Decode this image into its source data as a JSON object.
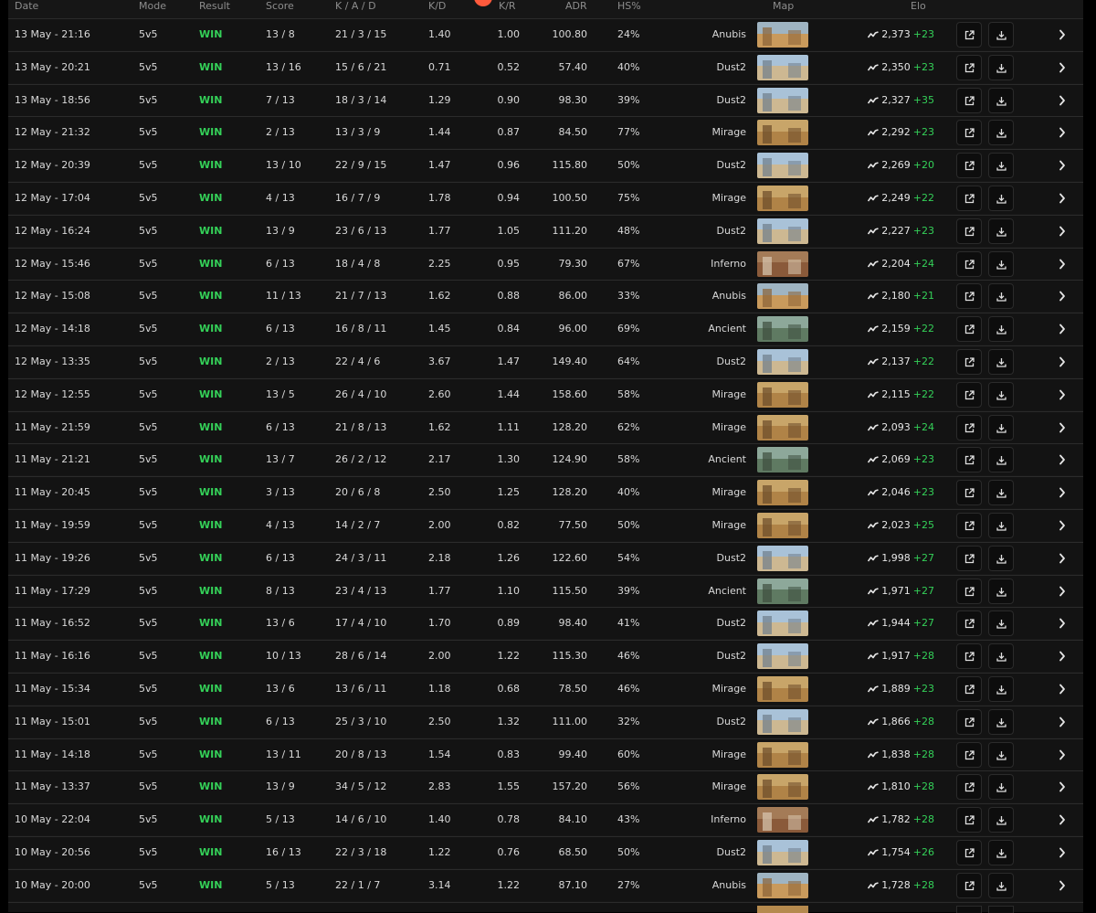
{
  "header": {
    "date": "Date",
    "mode": "Mode",
    "result": "Result",
    "score": "Score",
    "kad": "K / A / D",
    "kd": "K/D",
    "kr": "K/R",
    "adr": "ADR",
    "hs": "HS%",
    "map": "Map",
    "elo": "Elo"
  },
  "colors": {
    "win": "#34d058",
    "delta": "#34d058",
    "background": "#161616",
    "logo": "#ff5a3c"
  },
  "icons": {
    "trend": "trend-chart-icon",
    "external": "external-link-icon",
    "download": "download-icon",
    "chevron": "chevron-right-icon"
  },
  "matches": [
    {
      "date": "13 May - 21:16",
      "mode": "5v5",
      "result": "WIN",
      "score": "13 / 8",
      "kad": "21 / 3 / 15",
      "kd": "1.40",
      "kr": "1.00",
      "adr": "100.80",
      "hs": "24%",
      "map": "Anubis",
      "elo": "2,373",
      "delta": "+23"
    },
    {
      "date": "13 May - 20:21",
      "mode": "5v5",
      "result": "WIN",
      "score": "13 / 16",
      "kad": "15 / 6 / 21",
      "kd": "0.71",
      "kr": "0.52",
      "adr": "57.40",
      "hs": "40%",
      "map": "Dust2",
      "elo": "2,350",
      "delta": "+23"
    },
    {
      "date": "13 May - 18:56",
      "mode": "5v5",
      "result": "WIN",
      "score": "7 / 13",
      "kad": "18 / 3 / 14",
      "kd": "1.29",
      "kr": "0.90",
      "adr": "98.30",
      "hs": "39%",
      "map": "Dust2",
      "elo": "2,327",
      "delta": "+35"
    },
    {
      "date": "12 May - 21:32",
      "mode": "5v5",
      "result": "WIN",
      "score": "2 / 13",
      "kad": "13 / 3 / 9",
      "kd": "1.44",
      "kr": "0.87",
      "adr": "84.50",
      "hs": "77%",
      "map": "Mirage",
      "elo": "2,292",
      "delta": "+23"
    },
    {
      "date": "12 May - 20:39",
      "mode": "5v5",
      "result": "WIN",
      "score": "13 / 10",
      "kad": "22 / 9 / 15",
      "kd": "1.47",
      "kr": "0.96",
      "adr": "115.80",
      "hs": "50%",
      "map": "Dust2",
      "elo": "2,269",
      "delta": "+20"
    },
    {
      "date": "12 May - 17:04",
      "mode": "5v5",
      "result": "WIN",
      "score": "4 / 13",
      "kad": "16 / 7 / 9",
      "kd": "1.78",
      "kr": "0.94",
      "adr": "100.50",
      "hs": "75%",
      "map": "Mirage",
      "elo": "2,249",
      "delta": "+22"
    },
    {
      "date": "12 May - 16:24",
      "mode": "5v5",
      "result": "WIN",
      "score": "13 / 9",
      "kad": "23 / 6 / 13",
      "kd": "1.77",
      "kr": "1.05",
      "adr": "111.20",
      "hs": "48%",
      "map": "Dust2",
      "elo": "2,227",
      "delta": "+23"
    },
    {
      "date": "12 May - 15:46",
      "mode": "5v5",
      "result": "WIN",
      "score": "6 / 13",
      "kad": "18 / 4 / 8",
      "kd": "2.25",
      "kr": "0.95",
      "adr": "79.30",
      "hs": "67%",
      "map": "Inferno",
      "elo": "2,204",
      "delta": "+24"
    },
    {
      "date": "12 May - 15:08",
      "mode": "5v5",
      "result": "WIN",
      "score": "11 / 13",
      "kad": "21 / 7 / 13",
      "kd": "1.62",
      "kr": "0.88",
      "adr": "86.00",
      "hs": "33%",
      "map": "Anubis",
      "elo": "2,180",
      "delta": "+21"
    },
    {
      "date": "12 May - 14:18",
      "mode": "5v5",
      "result": "WIN",
      "score": "6 / 13",
      "kad": "16 / 8 / 11",
      "kd": "1.45",
      "kr": "0.84",
      "adr": "96.00",
      "hs": "69%",
      "map": "Ancient",
      "elo": "2,159",
      "delta": "+22"
    },
    {
      "date": "12 May - 13:35",
      "mode": "5v5",
      "result": "WIN",
      "score": "2 / 13",
      "kad": "22 / 4 / 6",
      "kd": "3.67",
      "kr": "1.47",
      "adr": "149.40",
      "hs": "64%",
      "map": "Dust2",
      "elo": "2,137",
      "delta": "+22"
    },
    {
      "date": "12 May - 12:55",
      "mode": "5v5",
      "result": "WIN",
      "score": "13 / 5",
      "kad": "26 / 4 / 10",
      "kd": "2.60",
      "kr": "1.44",
      "adr": "158.60",
      "hs": "58%",
      "map": "Mirage",
      "elo": "2,115",
      "delta": "+22"
    },
    {
      "date": "11 May - 21:59",
      "mode": "5v5",
      "result": "WIN",
      "score": "6 / 13",
      "kad": "21 / 8 / 13",
      "kd": "1.62",
      "kr": "1.11",
      "adr": "128.20",
      "hs": "62%",
      "map": "Mirage",
      "elo": "2,093",
      "delta": "+24"
    },
    {
      "date": "11 May - 21:21",
      "mode": "5v5",
      "result": "WIN",
      "score": "13 / 7",
      "kad": "26 / 2 / 12",
      "kd": "2.17",
      "kr": "1.30",
      "adr": "124.90",
      "hs": "58%",
      "map": "Ancient",
      "elo": "2,069",
      "delta": "+23"
    },
    {
      "date": "11 May - 20:45",
      "mode": "5v5",
      "result": "WIN",
      "score": "3 / 13",
      "kad": "20 / 6 / 8",
      "kd": "2.50",
      "kr": "1.25",
      "adr": "128.20",
      "hs": "40%",
      "map": "Mirage",
      "elo": "2,046",
      "delta": "+23"
    },
    {
      "date": "11 May - 19:59",
      "mode": "5v5",
      "result": "WIN",
      "score": "4 / 13",
      "kad": "14 / 2 / 7",
      "kd": "2.00",
      "kr": "0.82",
      "adr": "77.50",
      "hs": "50%",
      "map": "Mirage",
      "elo": "2,023",
      "delta": "+25"
    },
    {
      "date": "11 May - 19:26",
      "mode": "5v5",
      "result": "WIN",
      "score": "6 / 13",
      "kad": "24 / 3 / 11",
      "kd": "2.18",
      "kr": "1.26",
      "adr": "122.60",
      "hs": "54%",
      "map": "Dust2",
      "elo": "1,998",
      "delta": "+27"
    },
    {
      "date": "11 May - 17:29",
      "mode": "5v5",
      "result": "WIN",
      "score": "8 / 13",
      "kad": "23 / 4 / 13",
      "kd": "1.77",
      "kr": "1.10",
      "adr": "115.50",
      "hs": "39%",
      "map": "Ancient",
      "elo": "1,971",
      "delta": "+27"
    },
    {
      "date": "11 May - 16:52",
      "mode": "5v5",
      "result": "WIN",
      "score": "13 / 6",
      "kad": "17 / 4 / 10",
      "kd": "1.70",
      "kr": "0.89",
      "adr": "98.40",
      "hs": "41%",
      "map": "Dust2",
      "elo": "1,944",
      "delta": "+27"
    },
    {
      "date": "11 May - 16:16",
      "mode": "5v5",
      "result": "WIN",
      "score": "10 / 13",
      "kad": "28 / 6 / 14",
      "kd": "2.00",
      "kr": "1.22",
      "adr": "115.30",
      "hs": "46%",
      "map": "Dust2",
      "elo": "1,917",
      "delta": "+28"
    },
    {
      "date": "11 May - 15:34",
      "mode": "5v5",
      "result": "WIN",
      "score": "13 / 6",
      "kad": "13 / 6 / 11",
      "kd": "1.18",
      "kr": "0.68",
      "adr": "78.50",
      "hs": "46%",
      "map": "Mirage",
      "elo": "1,889",
      "delta": "+23"
    },
    {
      "date": "11 May - 15:01",
      "mode": "5v5",
      "result": "WIN",
      "score": "6 / 13",
      "kad": "25 / 3 / 10",
      "kd": "2.50",
      "kr": "1.32",
      "adr": "111.00",
      "hs": "32%",
      "map": "Dust2",
      "elo": "1,866",
      "delta": "+28"
    },
    {
      "date": "11 May - 14:18",
      "mode": "5v5",
      "result": "WIN",
      "score": "13 / 11",
      "kad": "20 / 8 / 13",
      "kd": "1.54",
      "kr": "0.83",
      "adr": "99.40",
      "hs": "60%",
      "map": "Mirage",
      "elo": "1,838",
      "delta": "+28"
    },
    {
      "date": "11 May - 13:37",
      "mode": "5v5",
      "result": "WIN",
      "score": "13 / 9",
      "kad": "34 / 5 / 12",
      "kd": "2.83",
      "kr": "1.55",
      "adr": "157.20",
      "hs": "56%",
      "map": "Mirage",
      "elo": "1,810",
      "delta": "+28"
    },
    {
      "date": "10 May - 22:04",
      "mode": "5v5",
      "result": "WIN",
      "score": "5 / 13",
      "kad": "14 / 6 / 10",
      "kd": "1.40",
      "kr": "0.78",
      "adr": "84.10",
      "hs": "43%",
      "map": "Inferno",
      "elo": "1,782",
      "delta": "+28"
    },
    {
      "date": "10 May - 20:56",
      "mode": "5v5",
      "result": "WIN",
      "score": "16 / 13",
      "kad": "22 / 3 / 18",
      "kd": "1.22",
      "kr": "0.76",
      "adr": "68.50",
      "hs": "50%",
      "map": "Dust2",
      "elo": "1,754",
      "delta": "+26"
    },
    {
      "date": "10 May - 20:00",
      "mode": "5v5",
      "result": "WIN",
      "score": "5 / 13",
      "kad": "22 / 1 / 7",
      "kd": "3.14",
      "kr": "1.22",
      "adr": "87.10",
      "hs": "27%",
      "map": "Anubis",
      "elo": "1,728",
      "delta": "+28"
    }
  ]
}
